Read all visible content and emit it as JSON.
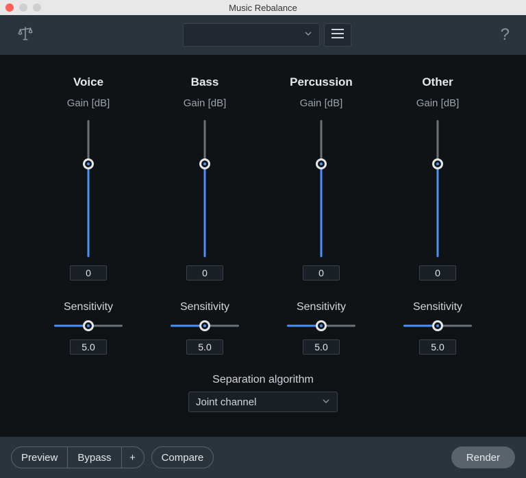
{
  "window": {
    "title": "Music Rebalance"
  },
  "topbar": {
    "preset_value": "",
    "hamburger_name": "menu-icon",
    "help": "?"
  },
  "channels": [
    {
      "title": "Voice",
      "gain_label": "Gain [dB]",
      "gain_value": "0",
      "sensitivity_label": "Sensitivity",
      "sensitivity_value": "5.0"
    },
    {
      "title": "Bass",
      "gain_label": "Gain [dB]",
      "gain_value": "0",
      "sensitivity_label": "Sensitivity",
      "sensitivity_value": "5.0"
    },
    {
      "title": "Percussion",
      "gain_label": "Gain [dB]",
      "gain_value": "0",
      "sensitivity_label": "Sensitivity",
      "sensitivity_value": "5.0"
    },
    {
      "title": "Other",
      "gain_label": "Gain [dB]",
      "gain_value": "0",
      "sensitivity_label": "Sensitivity",
      "sensitivity_value": "5.0"
    }
  ],
  "separation": {
    "label": "Separation algorithm",
    "value": "Joint channel"
  },
  "bottom": {
    "preview": "Preview",
    "bypass": "Bypass",
    "plus": "+",
    "compare": "Compare",
    "render": "Render"
  }
}
